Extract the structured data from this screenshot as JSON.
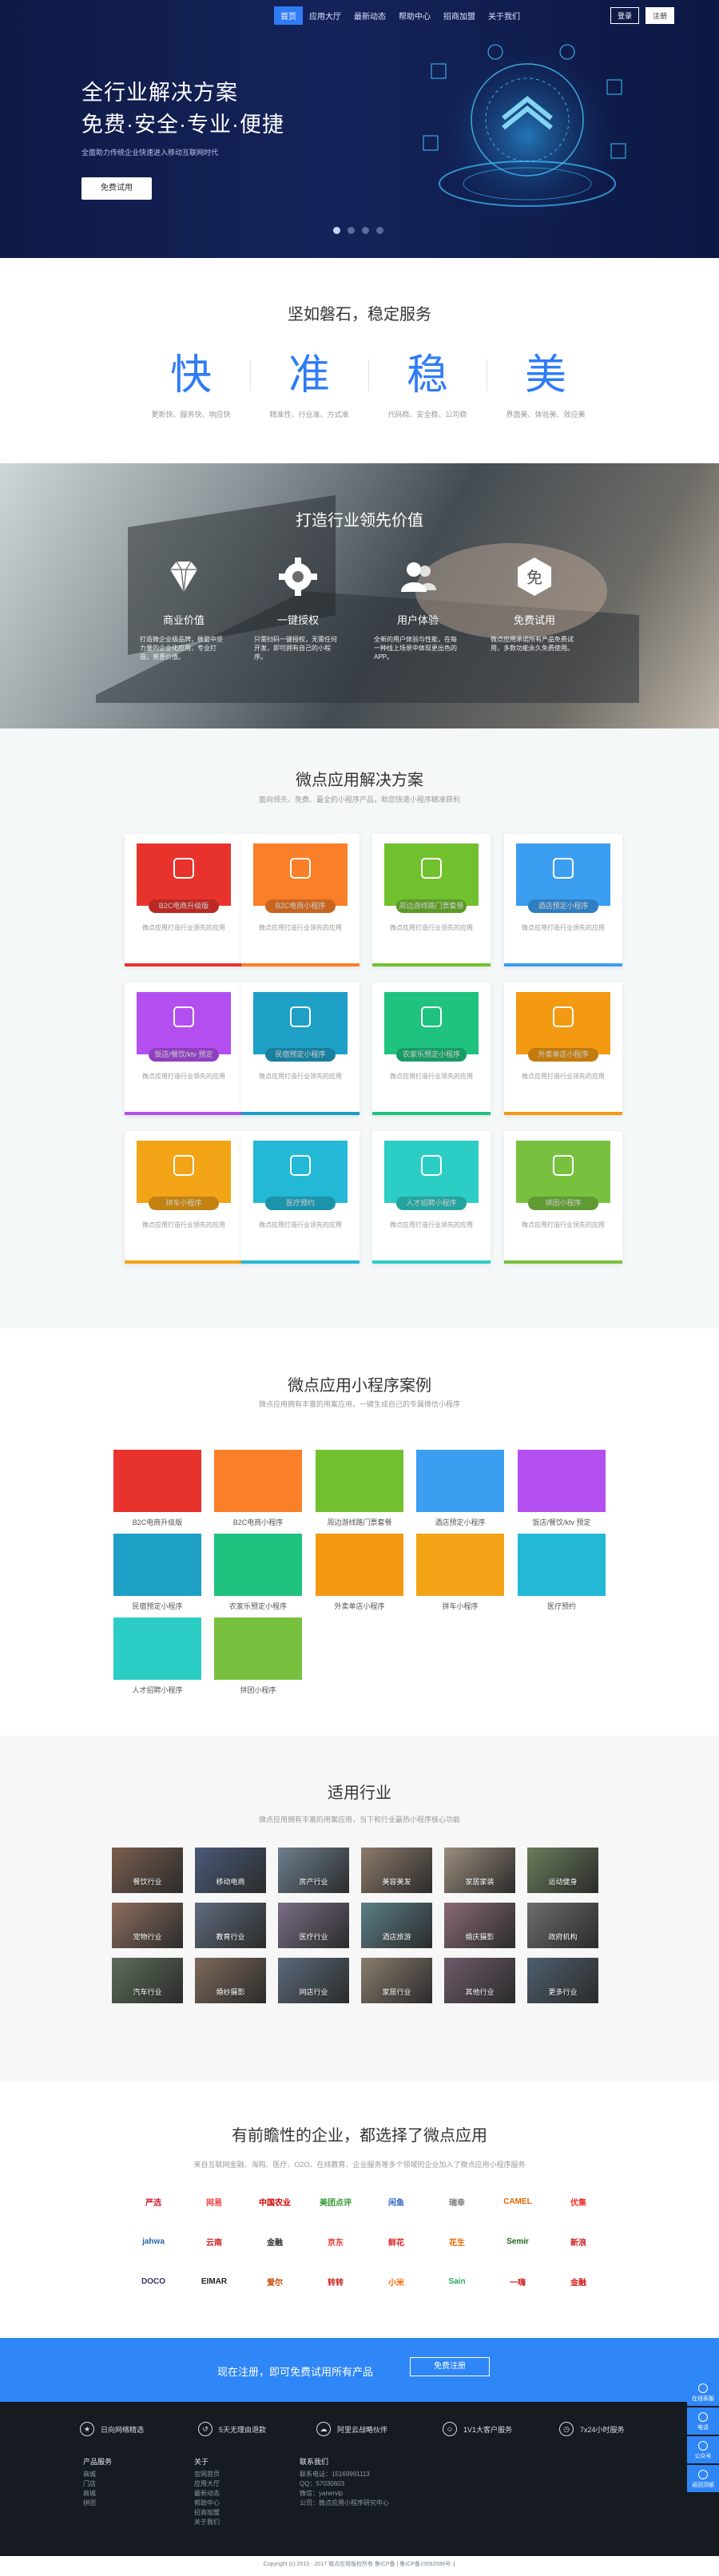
{
  "nav": {
    "links": [
      "首页",
      "应用大厅",
      "最新动态",
      "帮助中心",
      "招商加盟",
      "关于我们"
    ],
    "login": "登录",
    "register": "注册"
  },
  "hero": {
    "title1": "全行业解决方案",
    "title2": "免费·安全·专业·便捷",
    "subtitle": "全面助力传统企业快速进入移动互联网时代",
    "button": "免费试用"
  },
  "stable": {
    "title": "坚如磐石，稳定服务",
    "items": [
      {
        "char": "快",
        "desc": "更新快、服务快、响应快"
      },
      {
        "char": "准",
        "desc": "精准性、行业准、方式准"
      },
      {
        "char": "稳",
        "desc": "代码稳、安全稳、公司稳"
      },
      {
        "char": "美",
        "desc": "界面美、体验美、效应美"
      }
    ]
  },
  "value": {
    "title": "打造行业领先价值",
    "items": [
      {
        "title": "商业价值",
        "desc": "打造微企业级品牌，做最中坚力量的企业化应用，专业打造，普惠价值。"
      },
      {
        "title": "一键授权",
        "desc": "只需扫码一键授权，无需任何开发，即可拥有自己的小程序。"
      },
      {
        "title": "用户体验",
        "desc": "全新的用户体验与性能，在每一种线上场景中体现更出色的APP。"
      },
      {
        "title": "免费试用",
        "desc": "微点应用承诺所有产品免费试用，多数功能永久免费使用。"
      }
    ]
  },
  "solutions": {
    "title": "微点应用解决方案",
    "subtitle": "面向领先、免费、最全的小程序产品，助您快速小程序精准获利",
    "desc": "微点应用打造行业领先的应用",
    "items": [
      {
        "label": "B2C电商升级版",
        "color": "#e8332d",
        "bar": "#e8332d"
      },
      {
        "label": "B2C电商小程序",
        "color": "#fa7f28",
        "bar": "#fa7f28"
      },
      {
        "label": "周边游线路门票套餐",
        "color": "#71c12f",
        "bar": "#71c12f"
      },
      {
        "label": "酒店预定小程序",
        "color": "#3b9ef0",
        "bar": "#3b9ef0"
      },
      {
        "label": "饭店/餐饮/ktv 预定",
        "color": "#b34ff0",
        "bar": "#b34ff0"
      },
      {
        "label": "民宿预定小程序",
        "color": "#1e9fc6",
        "bar": "#1e9fc6"
      },
      {
        "label": "农家乐预定小程序",
        "color": "#1fc27f",
        "bar": "#1fc27f"
      },
      {
        "label": "外卖单店小程序",
        "color": "#f39a12",
        "bar": "#f39a12"
      },
      {
        "label": "拼车小程序",
        "color": "#f2a316",
        "bar": "#f2a316"
      },
      {
        "label": "医疗预约",
        "color": "#23b8d6",
        "bar": "#23b8d6"
      },
      {
        "label": "人才招聘小程序",
        "color": "#2ccdc5",
        "bar": "#2ccdc5"
      },
      {
        "label": "拼团小程序",
        "color": "#78c13f",
        "bar": "#78c13f"
      }
    ]
  },
  "cases": {
    "title": "微点应用小程序案例",
    "subtitle": "微点应用拥有丰富的用案应用，一键生成自己的专属微信小程序",
    "items": [
      {
        "name": "B2C电商升级版",
        "color": "#e8332d"
      },
      {
        "name": "B2C电商小程序",
        "color": "#fa7f28"
      },
      {
        "name": "周边游线路门票套餐",
        "color": "#71c12f"
      },
      {
        "name": "酒店预定小程序",
        "color": "#3b9ef0"
      },
      {
        "name": "饭店/餐饮/ktv 预定",
        "color": "#b34ff0"
      },
      {
        "name": "民宿预定小程序",
        "color": "#1e9fc6"
      },
      {
        "name": "农家乐预定小程序",
        "color": "#1fc27f"
      },
      {
        "name": "外卖单店小程序",
        "color": "#f39a12"
      },
      {
        "name": "拼车小程序",
        "color": "#f2a316"
      },
      {
        "name": "医疗预约",
        "color": "#23b8d6"
      },
      {
        "name": "人才招聘小程序",
        "color": "#2ccdc5"
      },
      {
        "name": "拼团小程序",
        "color": "#78c13f"
      }
    ]
  },
  "industry": {
    "title": "适用行业",
    "subtitle": "微点应用拥有丰富的用案应用，当下和行业最热小程序核心功能",
    "items": [
      "餐饮行业",
      "移动电商",
      "房产行业",
      "美容美发",
      "家居家装",
      "运动健身",
      "宠物行业",
      "教育行业",
      "医疗行业",
      "酒店旅游",
      "婚庆摄影",
      "政府机构",
      "汽车行业",
      "婚纱摄影",
      "网店行业",
      "家居行业",
      "其他行业",
      "更多行业"
    ]
  },
  "clients": {
    "title": "有前瞻性的企业，都选择了微点应用",
    "subtitle": "来自互联网金融、海购、医疗、O2O、在线教育、企业服务等多个领域的企业加入了微点应用小程序服务",
    "logos": [
      "严选",
      "网易",
      "中国农业",
      "美团点评",
      "闲鱼",
      "瑞幸",
      "CAMEL",
      "优集",
      "jahwa",
      "云南",
      "金融",
      "京东",
      "鲜花",
      "花生",
      "Semir",
      "新浪",
      "DOCO",
      "EIMAR",
      "爱尔",
      "转转",
      "小米",
      "Sain",
      "一嗨",
      "金融"
    ]
  },
  "cta": {
    "text": "现在注册，即可免费试用所有产品",
    "button": "免费注册"
  },
  "footer": {
    "features": [
      "日向网络精选",
      "5天无理由退款",
      "阿里云战略伙伴",
      "1V1大客户服务",
      "7x24小时服务"
    ],
    "col1": {
      "title": "产品服务",
      "items": [
        "商城",
        "门店",
        "商城",
        "拼团"
      ]
    },
    "col2": {
      "title": "关于",
      "items": [
        "官网首页",
        "应用大厅",
        "最新动态",
        "帮助中心",
        "招商加盟",
        "关于我们"
      ]
    },
    "col3": {
      "title": "联系我们",
      "items": [
        "联系电话：15169991113",
        "QQ：57030603",
        "微信：yanervip",
        "公司：微点应用小程序研究中心"
      ]
    },
    "copyright": "Copyright (c) 2015 - 2017 微点应用版权所有 鲁ICP备 | 鲁ICP备15082086号-1",
    "side": [
      "在线客服",
      "电话",
      "公众号",
      "返回顶部"
    ]
  },
  "colors": {
    "brand": "#2f7cf6",
    "hero_bg": "#14235a",
    "cta": "#2f86f7",
    "footer": "#151b21"
  }
}
